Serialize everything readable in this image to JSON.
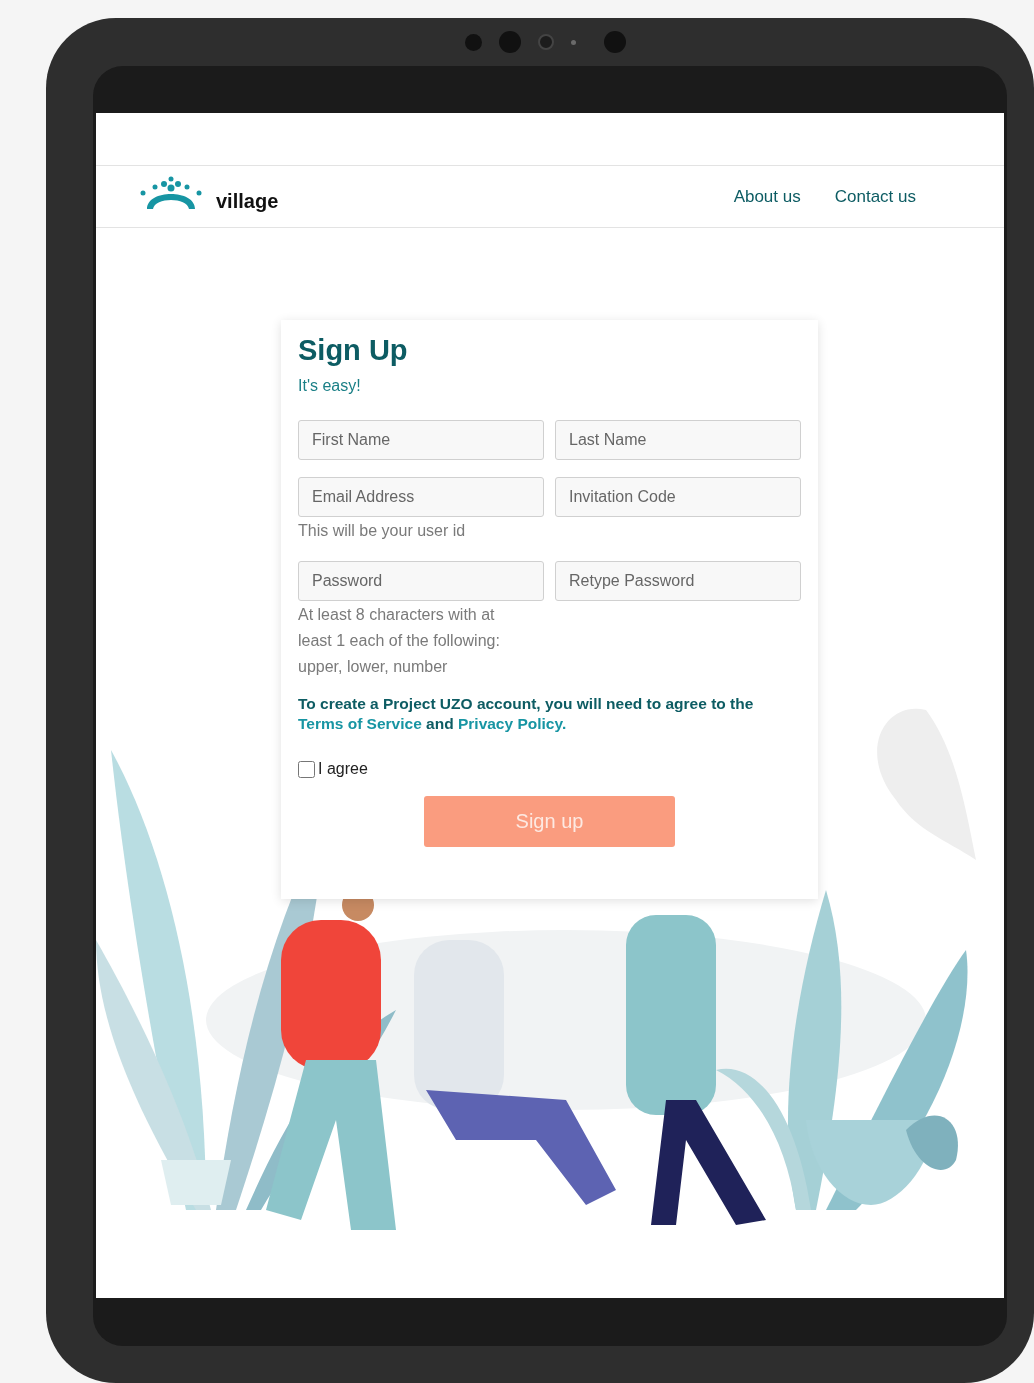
{
  "header": {
    "logo_text": "village",
    "nav": [
      {
        "label": "About us"
      },
      {
        "label": "Contact us"
      }
    ]
  },
  "signup": {
    "title": "Sign Up",
    "subtitle": "It's easy!",
    "fields": [
      {
        "placeholder": "First Name"
      },
      {
        "placeholder": "Last Name"
      },
      {
        "placeholder": "Email Address",
        "help": "This will be your user id"
      },
      {
        "placeholder": "Invitation Code"
      },
      {
        "placeholder": "Password",
        "help": "At least 8 characters with at least 1 each of the following: upper, lower, number"
      },
      {
        "placeholder": "Retype Password"
      }
    ],
    "consent": [
      {
        "kind": "text",
        "text": "To create a Project UZO account, you will need to agree to the "
      },
      {
        "kind": "link",
        "text": "Terms of Service"
      },
      {
        "kind": "text",
        "text": " and "
      },
      {
        "kind": "link",
        "text": "Privacy Policy."
      }
    ],
    "agree": {
      "label": "I agree",
      "checked": false
    },
    "button": {
      "label": "Sign up",
      "disabled": true
    }
  }
}
